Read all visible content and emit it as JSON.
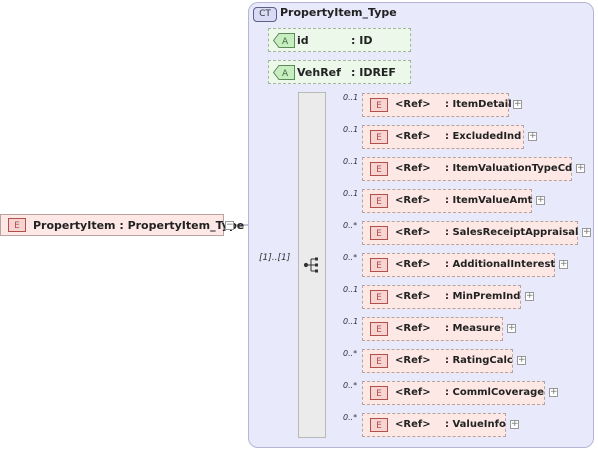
{
  "complex_type": {
    "badge": "CT",
    "title": "PropertyItem_Type"
  },
  "attributes": [
    {
      "badge": "A",
      "name": "id",
      "type": ": ID"
    },
    {
      "badge": "A",
      "name": "VehRef",
      "type": ": IDREF"
    }
  ],
  "element": {
    "badge": "E",
    "label": "PropertyItem : PropertyItem_Type",
    "toggle": "−"
  },
  "sequence": {
    "cardinality": "[1]..[1]"
  },
  "refs": [
    {
      "card": "0..1",
      "badge": "E",
      "ref": "<Ref>",
      "name": ": ItemDetail",
      "toggle": "+"
    },
    {
      "card": "0..1",
      "badge": "E",
      "ref": "<Ref>",
      "name": ": ExcludedInd",
      "toggle": "+"
    },
    {
      "card": "0..1",
      "badge": "E",
      "ref": "<Ref>",
      "name": ": ItemValuationTypeCd",
      "toggle": "+"
    },
    {
      "card": "0..1",
      "badge": "E",
      "ref": "<Ref>",
      "name": ": ItemValueAmt",
      "toggle": "+"
    },
    {
      "card": "0..*",
      "badge": "E",
      "ref": "<Ref>",
      "name": ": SalesReceiptAppraisal",
      "toggle": "+"
    },
    {
      "card": "0..*",
      "badge": "E",
      "ref": "<Ref>",
      "name": ": AdditionalInterest",
      "toggle": "+"
    },
    {
      "card": "0..1",
      "badge": "E",
      "ref": "<Ref>",
      "name": ": MinPremInd",
      "toggle": "+"
    },
    {
      "card": "0..1",
      "badge": "E",
      "ref": "<Ref>",
      "name": ": Measure",
      "toggle": "+"
    },
    {
      "card": "0..*",
      "badge": "E",
      "ref": "<Ref>",
      "name": ": RatingCalc",
      "toggle": "+"
    },
    {
      "card": "0..*",
      "badge": "E",
      "ref": "<Ref>",
      "name": ": CommlCoverage",
      "toggle": "+"
    },
    {
      "card": "0..*",
      "badge": "E",
      "ref": "<Ref>",
      "name": ": ValueInfo",
      "toggle": "+"
    }
  ]
}
